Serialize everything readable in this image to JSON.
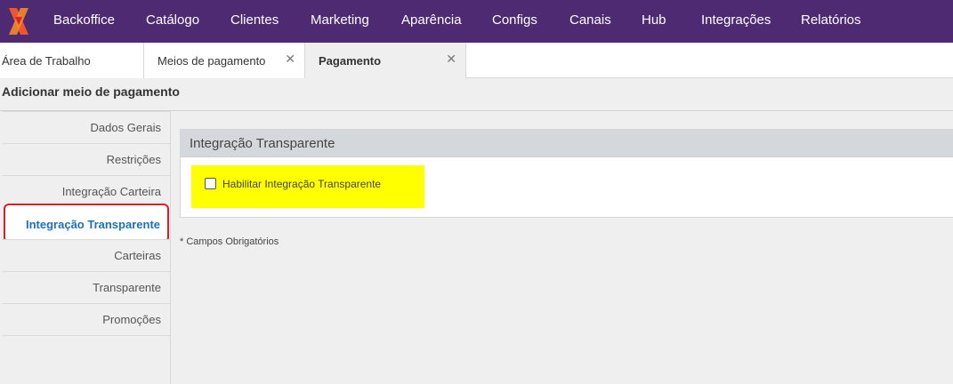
{
  "topnav": {
    "items": [
      "Backoffice",
      "Catálogo",
      "Clientes",
      "Marketing",
      "Aparência",
      "Configs",
      "Canais",
      "Hub",
      "Integrações",
      "Relatórios"
    ]
  },
  "tabs": [
    {
      "label": "Área de Trabalho"
    },
    {
      "label": "Meios de pagamento",
      "close": "✕"
    },
    {
      "label": "Pagamento",
      "close": "✕"
    }
  ],
  "page": {
    "title": "Adicionar meio de pagamento"
  },
  "sidemenu": {
    "items": [
      "Dados Gerais",
      "Restrições",
      "Integração Carteira",
      "Integração Transparente",
      "Carteiras",
      "Transparente",
      "Promoções"
    ]
  },
  "panel": {
    "title": "Integração Transparente",
    "checkbox_label": "Habilitar Integração Transparente"
  },
  "footer_note": "* Campos Obrigatórios",
  "colors": {
    "nav_bg": "#4e2a73",
    "active_link": "#1e6fbf",
    "highlight": "#ffff00",
    "focus_border": "#d72020"
  }
}
